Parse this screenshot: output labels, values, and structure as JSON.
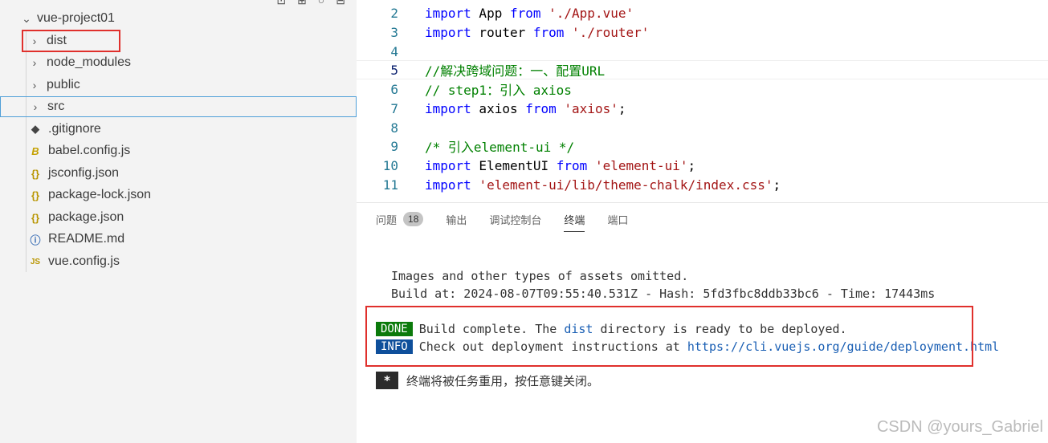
{
  "sidebar": {
    "root": {
      "label": "vue-project01"
    },
    "items": [
      {
        "label": "dist",
        "icon": "chevron-right-icon"
      },
      {
        "label": "node_modules",
        "icon": "chevron-right-icon"
      },
      {
        "label": "public",
        "icon": "chevron-right-icon"
      },
      {
        "label": "src",
        "icon": "chevron-right-icon"
      },
      {
        "label": ".gitignore",
        "icon": "git-icon",
        "icon_glyph": "◆"
      },
      {
        "label": "babel.config.js",
        "icon": "babel-icon",
        "icon_glyph": "B"
      },
      {
        "label": "jsconfig.json",
        "icon": "json-icon",
        "icon_glyph": "{}"
      },
      {
        "label": "package-lock.json",
        "icon": "json-icon",
        "icon_glyph": "{}"
      },
      {
        "label": "package.json",
        "icon": "json-icon",
        "icon_glyph": "{}"
      },
      {
        "label": "README.md",
        "icon": "info-icon",
        "icon_glyph": "ⓘ"
      },
      {
        "label": "vue.config.js",
        "icon": "js-icon",
        "icon_glyph": "JS"
      }
    ]
  },
  "editor": {
    "lines": [
      {
        "num": "2",
        "tokens": [
          [
            "kw",
            "import"
          ],
          [
            "id",
            " App "
          ],
          [
            "kw",
            "from"
          ],
          [
            "id",
            " "
          ],
          [
            "str",
            "'./App.vue'"
          ]
        ]
      },
      {
        "num": "3",
        "tokens": [
          [
            "kw",
            "import"
          ],
          [
            "id",
            " router "
          ],
          [
            "kw",
            "from"
          ],
          [
            "id",
            " "
          ],
          [
            "str",
            "'./router'"
          ]
        ]
      },
      {
        "num": "4",
        "tokens": []
      },
      {
        "num": "5",
        "tokens": [
          [
            "cm",
            "//解决跨域问题：一、配置URL"
          ]
        ],
        "current": true
      },
      {
        "num": "6",
        "tokens": [
          [
            "cm",
            "// step1：引入 axios"
          ]
        ]
      },
      {
        "num": "7",
        "tokens": [
          [
            "kw",
            "import"
          ],
          [
            "id",
            " axios "
          ],
          [
            "kw",
            "from"
          ],
          [
            "id",
            " "
          ],
          [
            "str",
            "'axios'"
          ],
          [
            "id",
            ";"
          ]
        ]
      },
      {
        "num": "8",
        "tokens": []
      },
      {
        "num": "9",
        "tokens": [
          [
            "cm",
            "/* 引入element-ui */"
          ]
        ]
      },
      {
        "num": "10",
        "tokens": [
          [
            "kw",
            "import"
          ],
          [
            "id",
            " ElementUI "
          ],
          [
            "kw",
            "from"
          ],
          [
            "id",
            " "
          ],
          [
            "str",
            "'element-ui'"
          ],
          [
            "id",
            ";"
          ]
        ]
      },
      {
        "num": "11",
        "tokens": [
          [
            "kw",
            "import"
          ],
          [
            "id",
            " "
          ],
          [
            "str",
            "'element-ui/lib/theme-chalk/index.css'"
          ],
          [
            "id",
            ";"
          ]
        ]
      }
    ]
  },
  "panel": {
    "tabs": [
      {
        "label": "问题",
        "badge": "18"
      },
      {
        "label": "输出"
      },
      {
        "label": "调试控制台"
      },
      {
        "label": "终端",
        "active": true
      },
      {
        "label": "端口"
      }
    ],
    "terminal": {
      "line1": "Images and other types of assets omitted.",
      "line2": "Build at: 2024-08-07T09:55:40.531Z - Hash: 5fd3fbc8ddb33bc6 - Time: 17443ms",
      "done_tag": "DONE",
      "done_pre": "Build complete. The ",
      "done_dist": "dist",
      "done_post": " directory is ready to be deployed.",
      "info_tag": "INFO",
      "info_pre": "Check out deployment instructions at ",
      "info_url": "https://cli.vuejs.org/guide/deployment.html",
      "star": "*",
      "close_msg": "终端将被任务重用，按任意键关闭。"
    }
  },
  "watermark": "CSDN @yours_Gabriel",
  "colors": {
    "highlight_box": "#e0302c",
    "done_bg": "#0b7a0b",
    "info_bg": "#0e4f9b"
  }
}
